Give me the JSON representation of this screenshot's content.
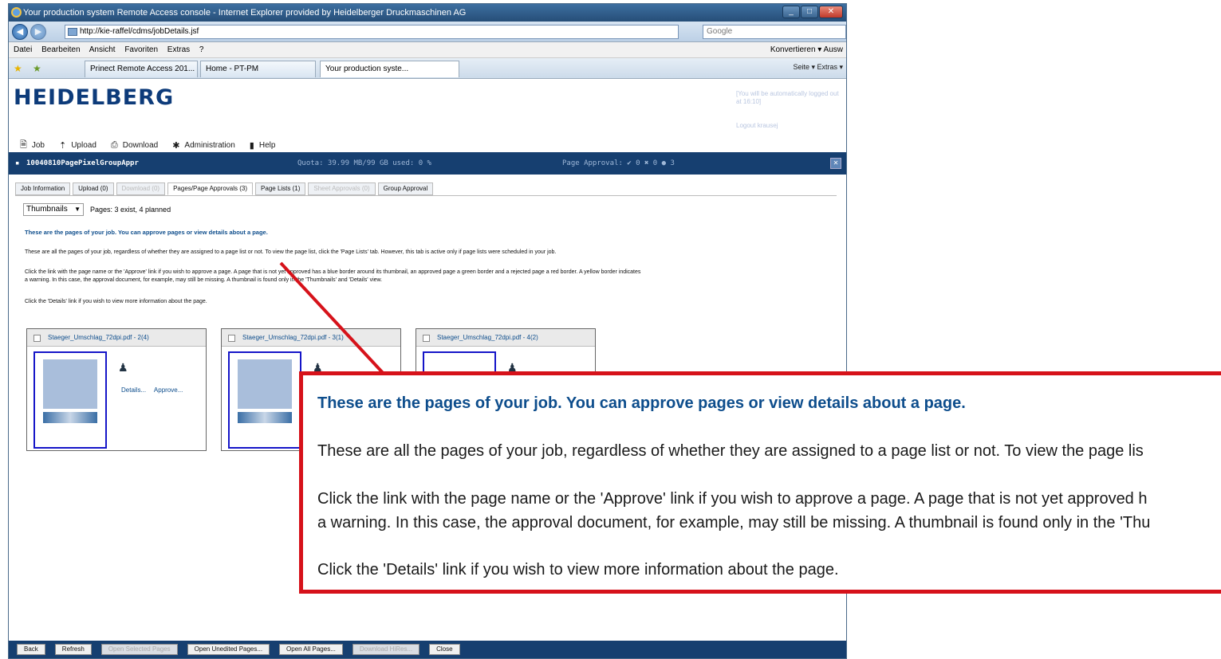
{
  "window": {
    "title": "Your production system Remote Access console - Internet Explorer provided by Heidelberger Druckmaschinen AG",
    "url": "http://kie-raffel/cdms/jobDetails.jsf",
    "search_placeholder": "Google"
  },
  "menubar": {
    "items": [
      "Datei",
      "Bearbeiten",
      "Ansicht",
      "Favoriten",
      "Extras",
      "?"
    ],
    "right": "Konvertieren ▾ Ausw"
  },
  "browser_tabs": [
    "Prinect Remote Access 201...",
    "Home - PT-PM",
    "Your production syste..."
  ],
  "browser_tools": "Seite ▾   Extras ▾",
  "app": {
    "logo": "HEIDELBERG",
    "logout_note": "[You will be automatically logged out at 16:10]",
    "logout_link": "Logout krausej",
    "menu": [
      "Job",
      "Upload",
      "Download",
      "Administration",
      "Help"
    ]
  },
  "jobbar": {
    "job_name": "10040810PagePixelGroupAppr",
    "quota": "Quota: 39.99 MB/99 GB used: 0 %",
    "approval": "Page Approval: ✔ 0 ✖ 0 ● 3"
  },
  "tabs": [
    {
      "label": "Job Information",
      "state": "normal"
    },
    {
      "label": "Upload (0)",
      "state": "normal"
    },
    {
      "label": "Download (0)",
      "state": "disabled"
    },
    {
      "label": "Pages/Page Approvals (3)",
      "state": "active"
    },
    {
      "label": "Page Lists (1)",
      "state": "normal"
    },
    {
      "label": "Sheet Approvals (0)",
      "state": "disabled"
    },
    {
      "label": "Group Approval",
      "state": "normal"
    }
  ],
  "view": {
    "selected": "Thumbnails",
    "pages_info": "Pages: 3 exist, 4 planned"
  },
  "info": {
    "heading": "These are the pages of your job. You can approve pages or view details about a page.",
    "p1": "These are all the pages of your job, regardless of whether they are assigned to a page list or not. To view the page list, click the 'Page Lists' tab. However, this tab is active only if page lists were scheduled in your job.",
    "p2a": "Click the link with the page name or the 'Approve' link if you wish to approve a page. A page that is not yet approved has a blue border around its thumbnail, an approved page a green border and a rejected page a red border. A yellow border indicates",
    "p2b": "a warning. In this case, the approval document, for example, may still be missing. A thumbnail is found only in the 'Thumbnails' and 'Details' view.",
    "p3": "Click the 'Details' link if you wish to view more information about the page."
  },
  "pages": [
    {
      "name": "Staeger_Umschlag_72dpi.pdf - 2(4)",
      "details": "Details...",
      "approve": "Approve..."
    },
    {
      "name": "Staeger_Umschlag_72dpi.pdf - 3(1)",
      "details": "",
      "approve": ""
    },
    {
      "name": "Staeger_Umschlag_72dpi.pdf - 4(2)",
      "details": "",
      "approve": ""
    }
  ],
  "bottom_buttons": [
    {
      "label": "Back",
      "enabled": true
    },
    {
      "label": "Refresh",
      "enabled": true
    },
    {
      "label": "Open Selected Pages",
      "enabled": false
    },
    {
      "label": "Open Unedited Pages...",
      "enabled": true
    },
    {
      "label": "Open All Pages...",
      "enabled": true
    },
    {
      "label": "Download HiRes...",
      "enabled": false
    },
    {
      "label": "Close",
      "enabled": true
    }
  ],
  "callout": {
    "heading": "These are the pages of your job. You can approve pages or view details about a page.",
    "p1": "These are all the pages of your job, regardless of whether they are assigned to a page list or not. To view the page lis",
    "p2a": "Click the link with the page name or the 'Approve' link if you wish to approve a page. A page that is not yet approved h",
    "p2b": "a warning. In this case, the approval document, for example, may still be missing. A thumbnail is found only in the 'Thu",
    "p3": "Click the 'Details' link if you wish to view more information about the page.",
    "border_color": "#d6121a"
  },
  "colors": {
    "heading_blue": "#0d4d8c",
    "jobbar_bg": "#163f70",
    "unapproved_border": "#1515c8"
  }
}
